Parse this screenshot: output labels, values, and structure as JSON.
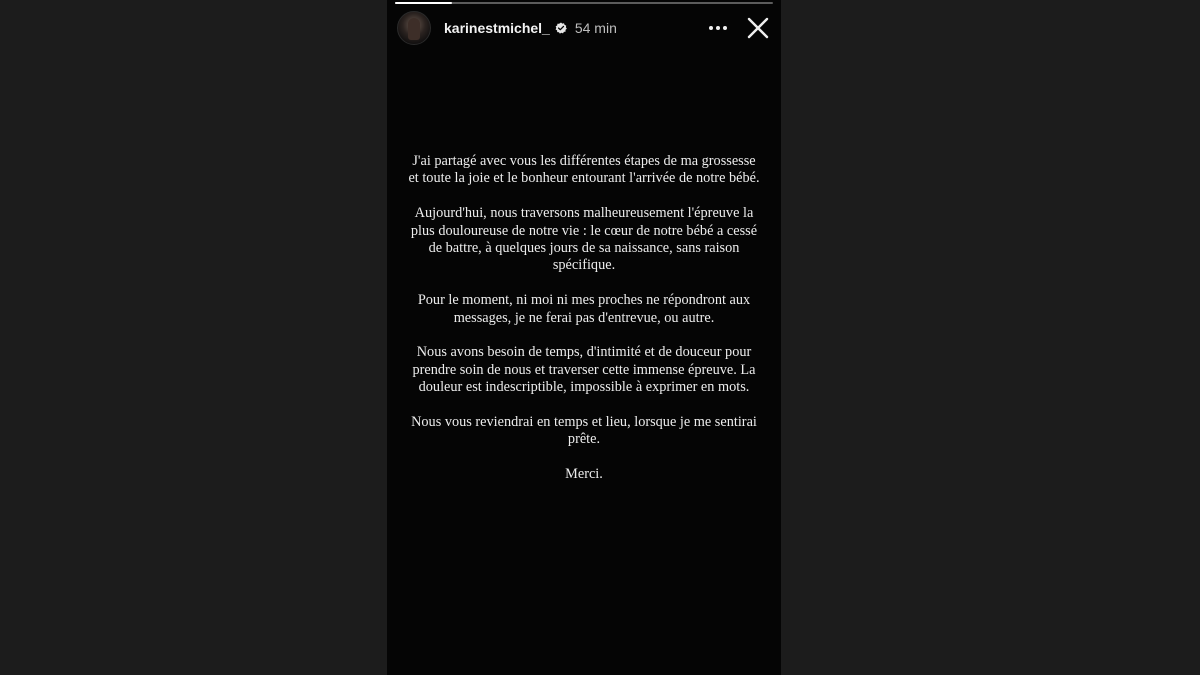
{
  "story": {
    "progress": 0.15,
    "username": "karinestmichel_",
    "time_ago": "54 min",
    "icons": {
      "avatar": "profile-avatar",
      "verified": "verified-badge-icon",
      "more": "more-horizontal-icon",
      "close": "close-icon"
    },
    "paragraphs": [
      "J'ai partagé avec vous les différentes étapes de ma grossesse et toute la joie et le bonheur entourant l'arrivée de notre bébé.",
      "Aujourd'hui, nous traversons malheureusement l'épreuve la plus douloureuse de notre vie : le cœur de notre bébé a cessé de battre, à quelques jours de sa naissance, sans raison spécifique.",
      "Pour le moment, ni moi ni mes proches ne répondront aux messages, je ne ferai pas d'entrevue, ou autre.",
      "Nous avons besoin de temps, d'intimité et de douceur pour prendre soin de nous et traverser cette immense épreuve. La douleur est indescriptible, impossible à exprimer en mots.",
      "Nous vous reviendrai en temps et lieu, lorsque je me sentirai prête.",
      "Merci."
    ]
  },
  "colors": {
    "page_background": "#1c1c1c",
    "story_background": "#050505",
    "text": "#ededed"
  }
}
